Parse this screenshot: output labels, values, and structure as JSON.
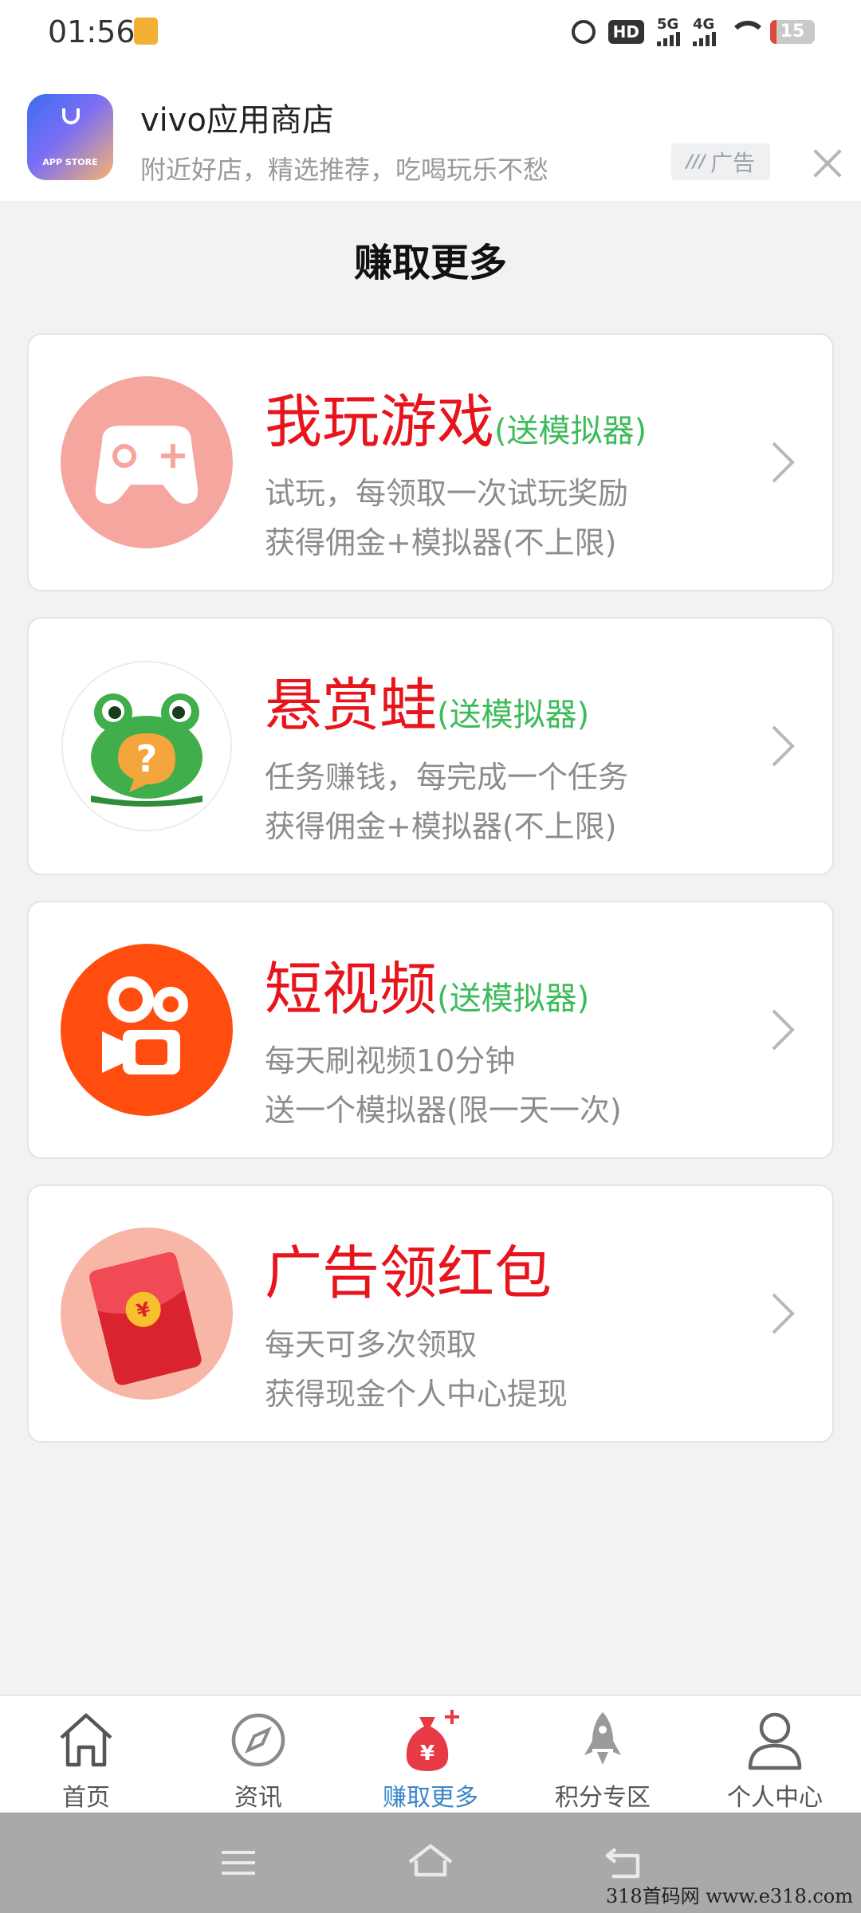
{
  "status_bar": {
    "time": "01:56",
    "hd_label": "HD",
    "signal_1": "5G",
    "signal_2": "4G",
    "battery_level": "15",
    "battery_fraction": 0.15
  },
  "ad": {
    "logo_text": "APP STORE",
    "title": "vivo应用商店",
    "subtitle": "附近好店，精选推荐，吃喝玩乐不愁",
    "badge_mark": "///",
    "badge_label": "广告"
  },
  "header": {
    "title": "赚取更多"
  },
  "cards": [
    {
      "title": "我玩游戏",
      "tag": "(送模拟器)",
      "line1": "试玩，每领取一次试玩奖励",
      "line2": "获得佣金+模拟器(不上限)",
      "icon": "gamepad-icon"
    },
    {
      "title": "悬赏蛙",
      "tag": "(送模拟器)",
      "line1": "任务赚钱，每完成一个任务",
      "line2": "获得佣金+模拟器(不上限)",
      "icon": "frog-icon"
    },
    {
      "title": "短视频",
      "tag": "(送模拟器)",
      "line1": "每天刷视频10分钟",
      "line2": "送一个模拟器(限一天一次)",
      "icon": "video-camera-icon"
    },
    {
      "title": "广告领红包",
      "tag": "",
      "line1": "每天可多次领取",
      "line2": "获得现金个人中心提现",
      "icon": "red-envelope-icon"
    }
  ],
  "bottom_nav": {
    "items": [
      {
        "label": "首页",
        "icon": "home-icon"
      },
      {
        "label": "资讯",
        "icon": "compass-icon"
      },
      {
        "label": "赚取更多",
        "icon": "money-bag-icon"
      },
      {
        "label": "积分专区",
        "icon": "rocket-icon"
      },
      {
        "label": "个人中心",
        "icon": "user-icon"
      }
    ],
    "active_index": 2
  },
  "watermark": "318首码网  www.e318.com",
  "colors": {
    "title_red": "#e8141c",
    "tag_green": "#3dbb5a",
    "desc_gray": "#8c8c8c",
    "nav_active": "#3a86c8"
  }
}
